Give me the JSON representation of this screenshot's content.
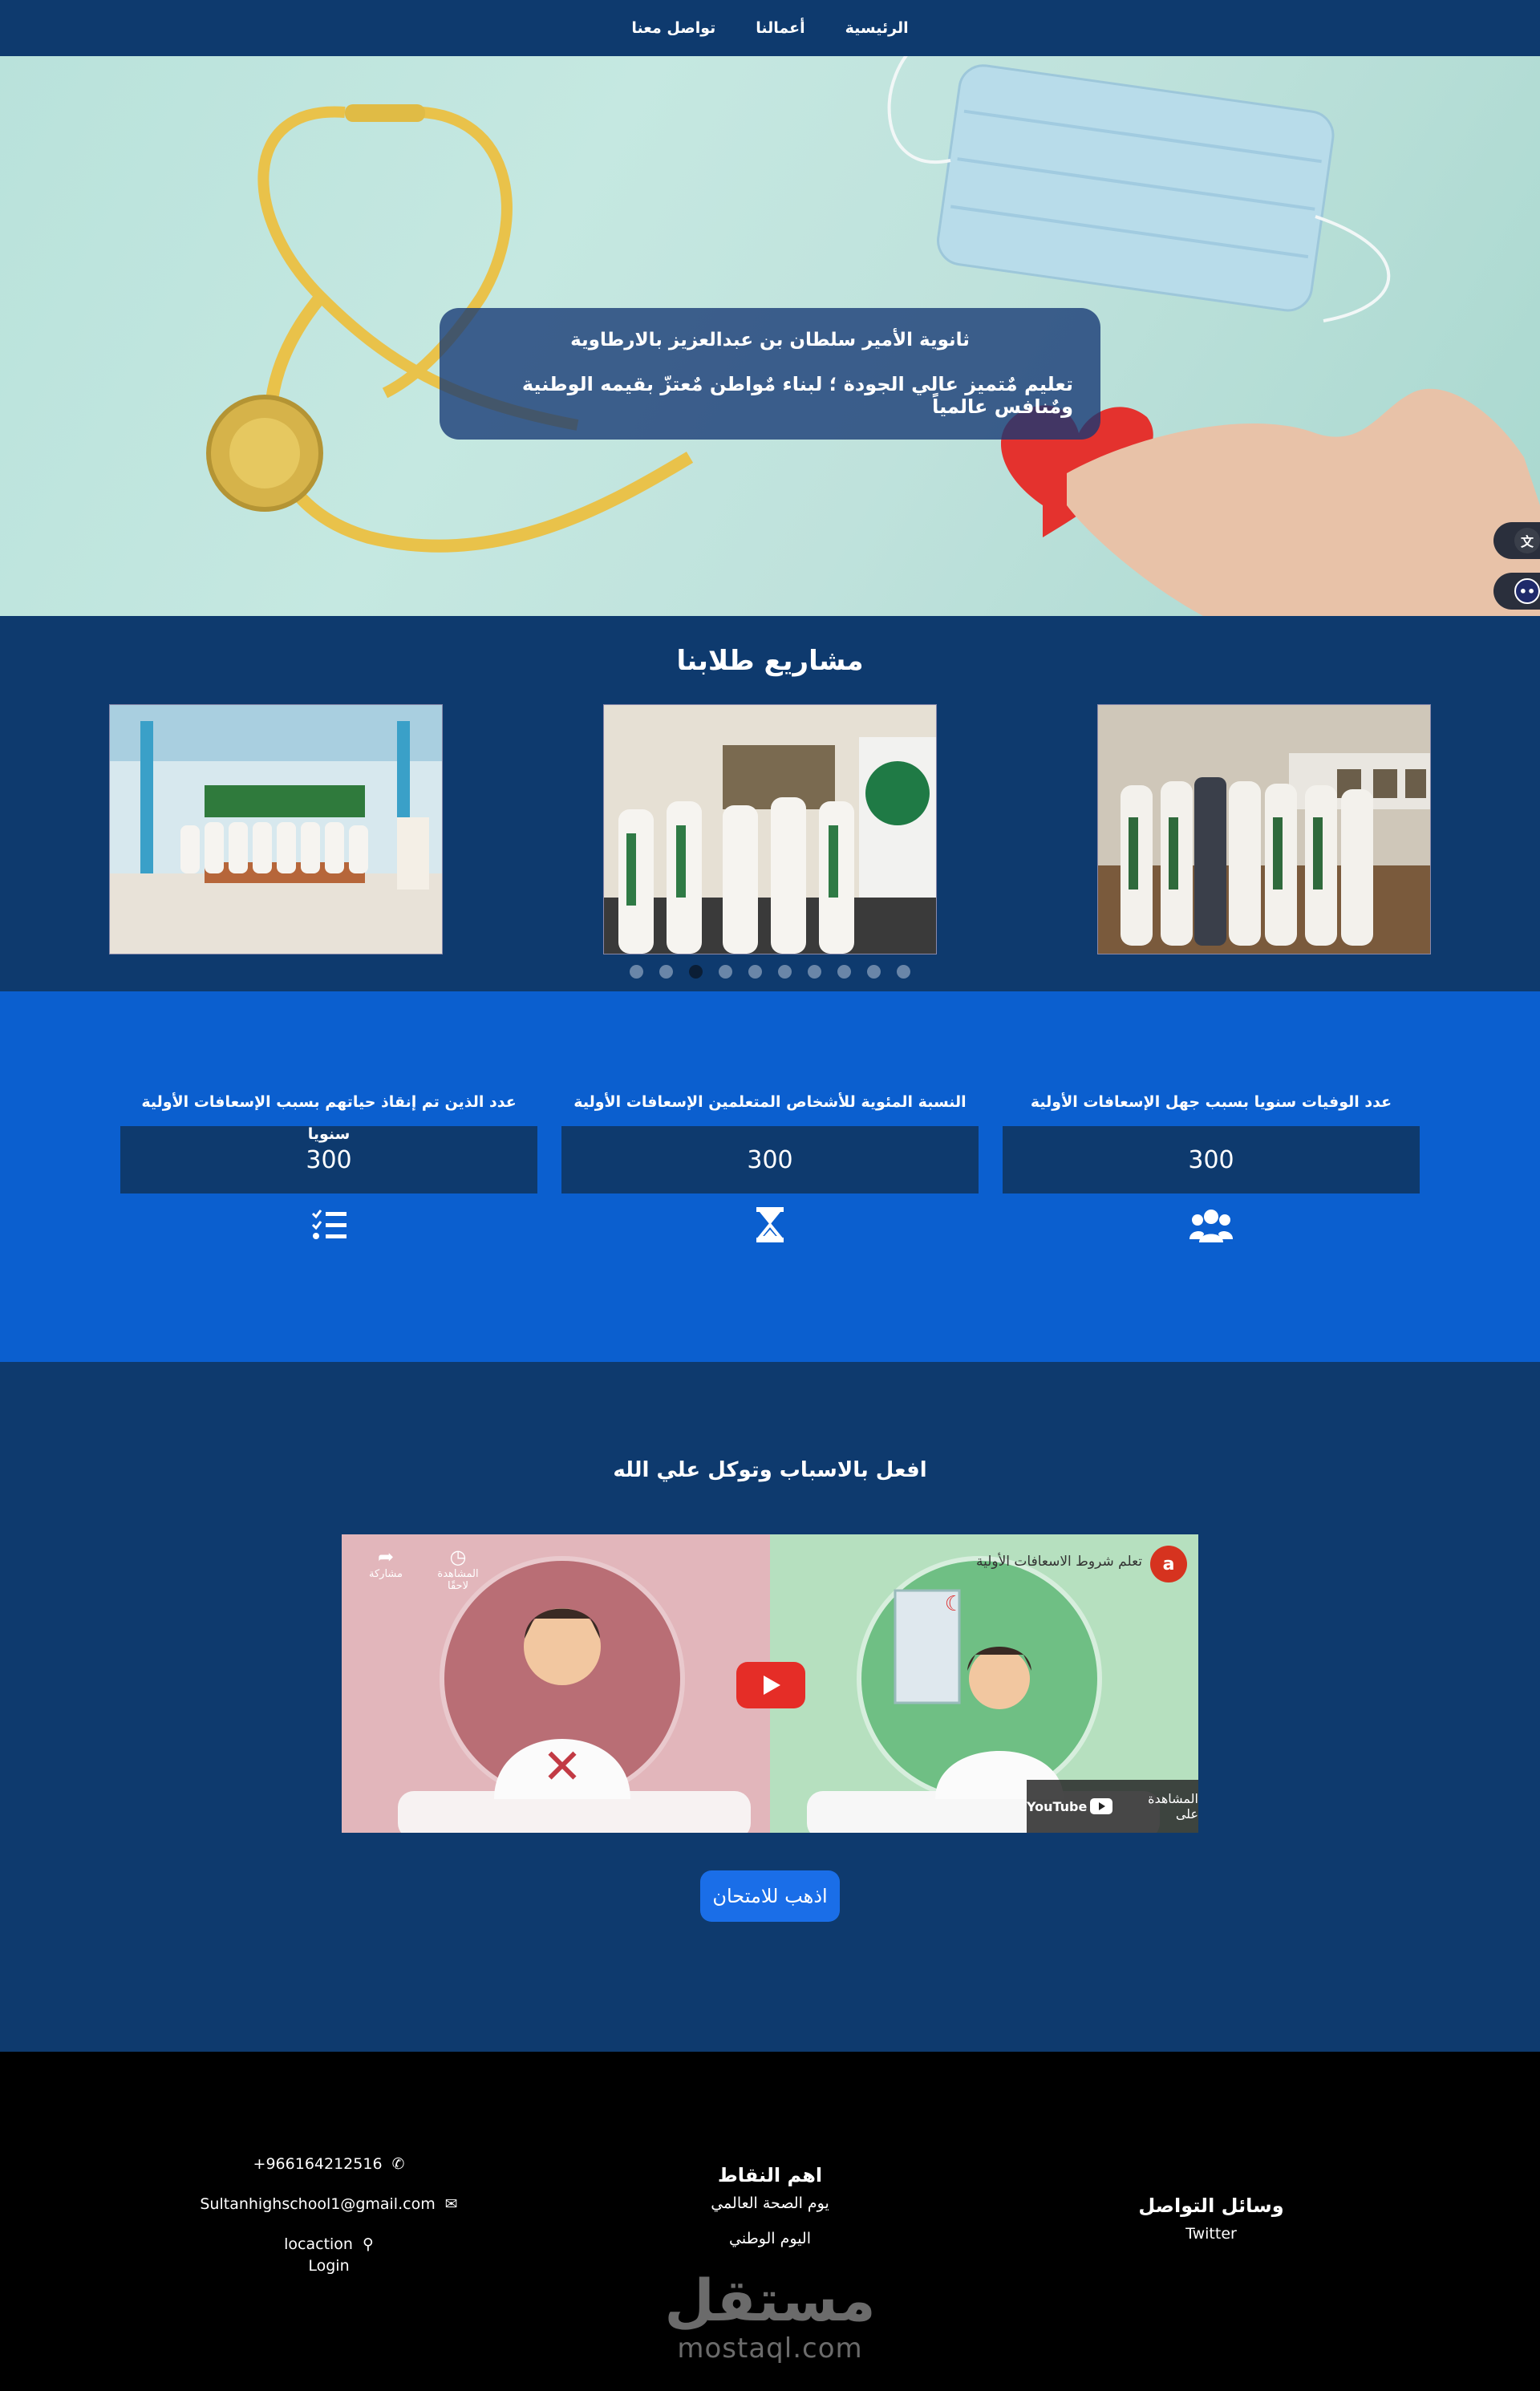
{
  "nav": {
    "items": [
      {
        "label": "الرئيسية"
      },
      {
        "label": "أعمالنا"
      },
      {
        "label": "تواصل معنا"
      }
    ]
  },
  "hero": {
    "title": "ثانوية الأمير سلطان بن عبدالعزيز بالارطاوية",
    "tagline": "تعليم مٌتميز عالي الجودة ؛ لبناء مٌواطن مٌعتزّ بقيمه الوطنية ومٌنافس عالمياً"
  },
  "projects": {
    "heading": "مشاريع طلابنا",
    "slides_total": 10,
    "active_slide": 3
  },
  "stats": [
    {
      "label": "عدد الوفيات سنويا بسبب جهل الإسعافات الأولية",
      "value": "300",
      "icon": "users-icon"
    },
    {
      "label": "النسبة المئوية للأشخاص المتعلمين الإسعافات الأولية",
      "value": "300",
      "icon": "hourglass-icon"
    },
    {
      "label": "عدد الذين تم إنقاذ حياتهم بسبب الإسعافات الأولية سنويا",
      "value": "300",
      "icon": "checklist-icon"
    }
  ],
  "video_section": {
    "heading": "افعل بالاسباب وتوكل علي الله",
    "video_title": "تعلم شروط الاسعافات الأولية",
    "channel_initial": "a",
    "share_label": "مشاركة",
    "watch_later_label": "المشاهدة لاحقًا",
    "watch_on_label": "المشاهدة على",
    "youtube_label": "YouTube",
    "exam_button": "اذهب للامتحان"
  },
  "footer": {
    "social": {
      "heading": "وسائل التواصل",
      "items": [
        "Twitter"
      ]
    },
    "highlights": {
      "heading": "اهم النقاط",
      "items": [
        "يوم الصحة العالمي",
        "اليوم الوطني"
      ]
    },
    "contact": {
      "phone": "966164212516+",
      "email": "Sultanhighschool1@gmail.com",
      "location": "locaction",
      "login": "Login"
    },
    "watermark_ar": "مستقل",
    "watermark_en": "mostaql.com"
  },
  "colors": {
    "nav_bg": "#0e3a6e",
    "stats_bg": "#0b5fcf",
    "footer_bg": "#000000",
    "button": "#1a6ee8"
  }
}
